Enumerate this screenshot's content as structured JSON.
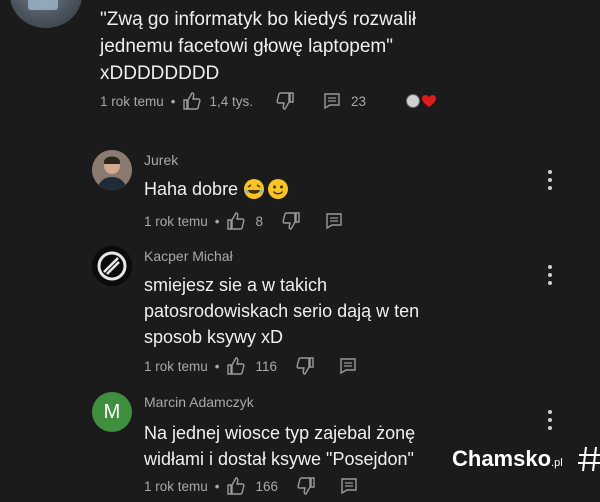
{
  "main_comment": {
    "text_lines": [
      "\"Zwą go informatyk bo kiedyś rozwalił",
      "jednemu facetowi głowę laptopem\"",
      "xDDDDDDDD"
    ],
    "time": "1 rok temu",
    "likes": "1,4 tys.",
    "replies": "23"
  },
  "replies": [
    {
      "name": "Jurek",
      "text_lines": [
        "Haha dobre"
      ],
      "time": "1 rok temu",
      "likes": "8"
    },
    {
      "name": "Kacper Michał",
      "text_lines": [
        "smiejesz sie a w takich",
        "patosrodowiskach serio dają w ten",
        "sposob ksywy xD"
      ],
      "time": "1 rok temu",
      "likes": "116"
    },
    {
      "name": "Marcin Adamczyk",
      "avatar_letter": "M",
      "text_lines": [
        "Na jednej wiosce typ zajebal żonę",
        "widłami i dostał ksywe \"Posejdon\""
      ],
      "time": "1 rok temu",
      "likes": "166"
    }
  ],
  "separator": "•",
  "watermark": {
    "brand": "Chamsko",
    "tld": ".pl"
  },
  "colors": {
    "background": "#1b1b1b",
    "heart": "#e01b1b",
    "avatar_m": "#3f8f3f"
  }
}
